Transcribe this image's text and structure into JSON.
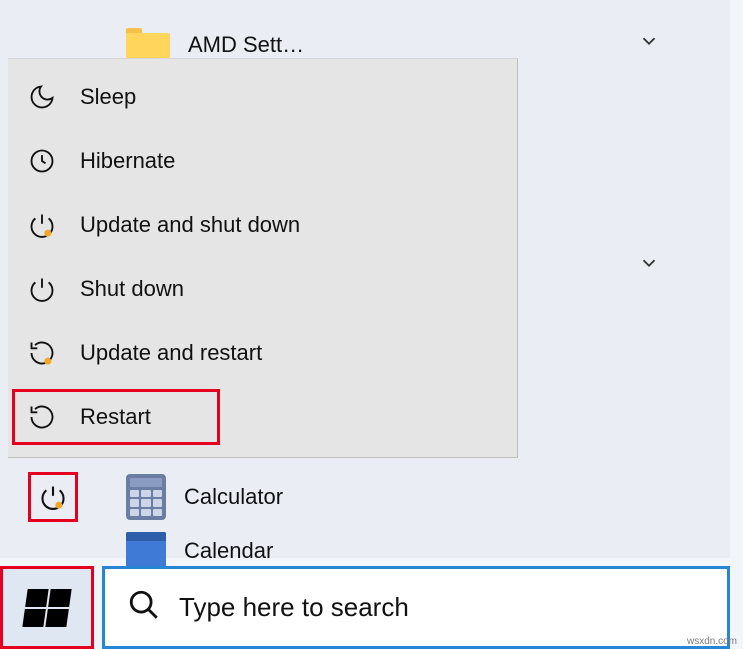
{
  "start": {
    "folder_label": "AMD Sett…",
    "power_menu": [
      {
        "id": "sleep",
        "label": "Sleep"
      },
      {
        "id": "hibernate",
        "label": "Hibernate"
      },
      {
        "id": "update-shutdown",
        "label": "Update and shut down"
      },
      {
        "id": "shutdown",
        "label": "Shut down"
      },
      {
        "id": "update-restart",
        "label": "Update and restart"
      },
      {
        "id": "restart",
        "label": "Restart"
      }
    ],
    "apps": {
      "calculator": "Calculator",
      "calendar": "Calendar"
    }
  },
  "taskbar": {
    "search_placeholder": "Type here to search"
  },
  "watermark": "wsxdn.com",
  "colors": {
    "highlight": "#e6001f",
    "search_border": "#2585d7",
    "menu_bg": "#e5e5e5"
  }
}
